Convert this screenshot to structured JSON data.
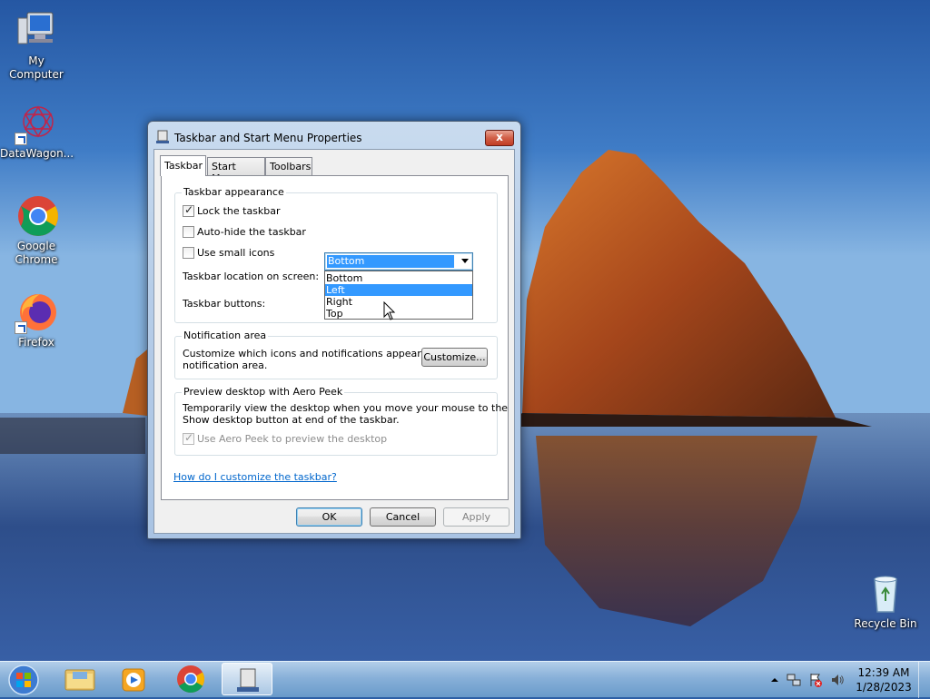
{
  "desktop": {
    "icons": [
      {
        "label": "My Computer",
        "icon": "computer-icon"
      },
      {
        "label": "DataWagon...",
        "icon": "datawagon-icon"
      },
      {
        "label": "Google Chrome",
        "icon": "chrome-icon"
      },
      {
        "label": "Firefox",
        "icon": "firefox-icon"
      },
      {
        "label": "Recycle Bin",
        "icon": "recycle-bin-icon"
      }
    ]
  },
  "dialog": {
    "title": "Taskbar and Start Menu Properties",
    "close_label": "x",
    "tabs": [
      {
        "label": "Taskbar",
        "active": true
      },
      {
        "label": "Start Menu",
        "active": false
      },
      {
        "label": "Toolbars",
        "active": false
      }
    ],
    "appearance": {
      "title": "Taskbar appearance",
      "lock_label": "Lock the taskbar",
      "lock_checked": true,
      "autohide_label": "Auto-hide the taskbar",
      "autohide_checked": false,
      "small_icons_label": "Use small icons",
      "small_icons_checked": false,
      "location_label": "Taskbar location on screen:",
      "location_value": "Bottom",
      "location_options": [
        "Bottom",
        "Left",
        "Right",
        "Top"
      ],
      "location_hovered": "Left",
      "buttons_label": "Taskbar buttons:"
    },
    "notification": {
      "title": "Notification area",
      "text_line1": "Customize which icons and notifications appear in the",
      "text_line2": "notification area.",
      "customize_label": "Customize..."
    },
    "aero_peek": {
      "title": "Preview desktop with Aero Peek",
      "text_line1": "Temporarily view the desktop when you move your mouse to the",
      "text_line2": "Show desktop button at end of the taskbar.",
      "checkbox_label": "Use Aero Peek to preview the desktop",
      "checkbox_checked": true
    },
    "help_link": "How do I customize the taskbar?",
    "ok_label": "OK",
    "cancel_label": "Cancel",
    "apply_label": "Apply"
  },
  "taskbar": {
    "apps": [
      "windows-explorer-icon",
      "media-player-icon",
      "chrome-icon",
      "taskbar-properties-icon"
    ],
    "time": "12:39 AM",
    "date": "1/28/2023"
  },
  "colors": {
    "selection": "#3399ff",
    "link": "#0066cc",
    "close_button": "#c74a33"
  }
}
